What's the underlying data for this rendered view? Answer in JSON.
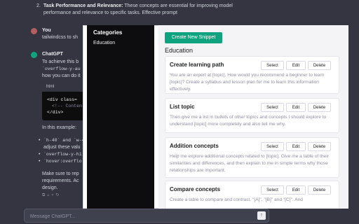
{
  "chat": {
    "list_number": "2.",
    "item_title": "Task Performance and Relevance:",
    "item_text_1": " These concepts are essential for improving model",
    "item_text_2": "performance and relevance to specific tasks. Effective prompt",
    "user_name": "You",
    "user_message": "tailwindcss to sh",
    "assistant_name": "ChatGPT",
    "reply_1": "To achieve this b",
    "reply_2": "`overflow-y-au",
    "reply_3": "how you can do it",
    "code_lang": "html",
    "code_1": "<div class=",
    "code_2": "<!-- Conten",
    "code_3": "</div>",
    "example_label": "In this example:",
    "bullet_1": "`h-40` and `w-4",
    "bullet_1b": "adjust these valu",
    "bullet_2": "`overflow-y-hi",
    "bullet_3": "`hover:overflo",
    "closing_1": "Make sure to rep",
    "closing_2": "requirements. Ac",
    "closing_3": "design.",
    "composer_placeholder": "Message ChatGPT..."
  },
  "panel": {
    "categories_title": "Categories",
    "category_items": [
      "Education"
    ],
    "create_button": "Create New Snippet",
    "section_title": "Education",
    "buttons": {
      "select": "Select",
      "edit": "Edit",
      "delete": "Delete"
    },
    "snippets": [
      {
        "title": "Create learning path",
        "desc": "You are an expert at [topic]. How would you recommend a beginner to learn [topic]? Create a syllabus and lesson plan for me to learn this information effectively."
      },
      {
        "title": "List topic",
        "desc": "Then give me a list in bullets of other topics and concepts I should explore to understand [topic] more completely and also tell me why."
      },
      {
        "title": "Addition concepts",
        "desc": "Help me explore additional concepts related to [topic]. Give me a table of their similarities and differences, and then explain to me in simple terms why those relationships are important."
      },
      {
        "title": "Compare concepts",
        "desc": "Create a table to compare and contrast. \"[A]\", \"[B]\" and \"[C]\". And"
      }
    ]
  },
  "colors": {
    "accent": "#10a37f",
    "chat_bg": "#343541",
    "sidebar_bg": "#0d0d0f",
    "user_avatar": "#b45f5f"
  }
}
